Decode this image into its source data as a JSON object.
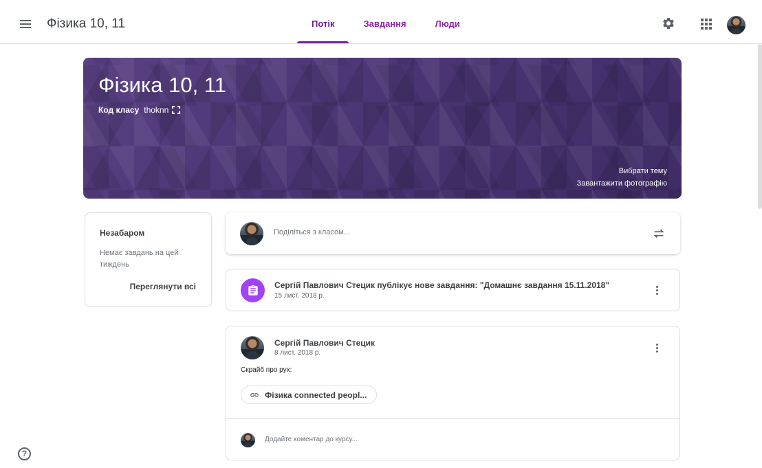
{
  "header": {
    "course_title": "Фізика 10, 11",
    "tabs": [
      {
        "label": "Потік",
        "active": true
      },
      {
        "label": "Завдання",
        "active": false
      },
      {
        "label": "Люди",
        "active": false
      }
    ],
    "icons": [
      "menu-icon",
      "gear-icon",
      "apps-grid-icon",
      "user-avatar"
    ]
  },
  "banner": {
    "title": "Фізика 10, 11",
    "class_code_label": "Код класу",
    "class_code": "thoknn",
    "choose_theme": "Вибрати тему",
    "upload_photo": "Завантажити фотографію",
    "color": "#4a3472"
  },
  "upcoming": {
    "title": "Незабаром",
    "empty_text": "Немає завдань на цей тиждень",
    "view_all": "Переглянути всі"
  },
  "share": {
    "placeholder": "Поділіться з класом..."
  },
  "stream": {
    "assignment": {
      "text": "Сергій Павлович Стецик публікує нове завдання: \"Домашнє завдання 15.11.2018\"",
      "date": "15 лист. 2018 р.",
      "icon_color": "#a142f4"
    },
    "post": {
      "author": "Сергій Павлович Стецик",
      "date": "8 лист. 2018 р.",
      "body": "Скрайб про рух:",
      "attachment": "Фізика connected peopl...",
      "comment_placeholder": "Додайте коментар до курсу..."
    }
  },
  "colors": {
    "accent": "#7b1fa2",
    "divider": "#dadce0"
  }
}
